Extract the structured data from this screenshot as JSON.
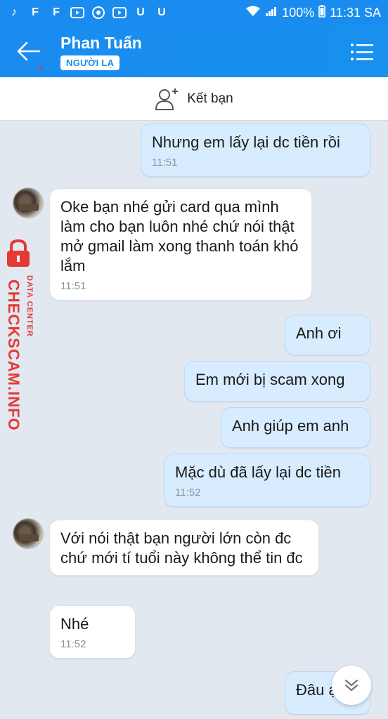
{
  "status_bar": {
    "battery": "100%",
    "time": "11:31 SA",
    "notif_icons": [
      "tiktok-icon",
      "f-icon",
      "f-icon",
      "youtube-icon",
      "chrome-icon",
      "youtube-icon",
      "u-icon",
      "u-icon"
    ],
    "letters": {
      "f": "F",
      "u": "U"
    }
  },
  "header": {
    "title": "Phan Tuấn",
    "badge": "NGƯỜI LẠ"
  },
  "add_friend": {
    "label": "Kết bạn"
  },
  "watermark": {
    "brand": "CHECKSCAM.INFO",
    "sub": "DATA CENTER"
  },
  "messages": [
    {
      "dir": "out",
      "text": "Nhưng em lấy lại dc tiền rồi",
      "time": "11:51"
    },
    {
      "dir": "in",
      "text": "Oke bạn nhé gửi card qua mình làm cho bạn luôn nhé chứ nói thật mở gmail làm xong thanh toán khó lắm",
      "time": "11:51"
    },
    {
      "dir": "out",
      "text": "Anh ơi",
      "time": ""
    },
    {
      "dir": "out",
      "text": "Em mới bị scam xong",
      "time": ""
    },
    {
      "dir": "out",
      "text": "Anh giúp em anh",
      "time": ""
    },
    {
      "dir": "out",
      "text": "Mặc dù đã lấy lại dc tiền",
      "time": "11:52"
    },
    {
      "dir": "in",
      "text": "Với nói thật bạn người lớn còn đc chứ mới tí tuổi này không thể tin đc",
      "time": ""
    },
    {
      "dir": "in",
      "text": "Nhé",
      "time": "11:52"
    },
    {
      "dir": "out",
      "text": "Đâu ạ",
      "time": ""
    }
  ],
  "colors": {
    "accent": "#1a8cf0",
    "bubble_out": "#d7ecff",
    "bubble_in": "#ffffff",
    "watermark": "#e53935"
  }
}
